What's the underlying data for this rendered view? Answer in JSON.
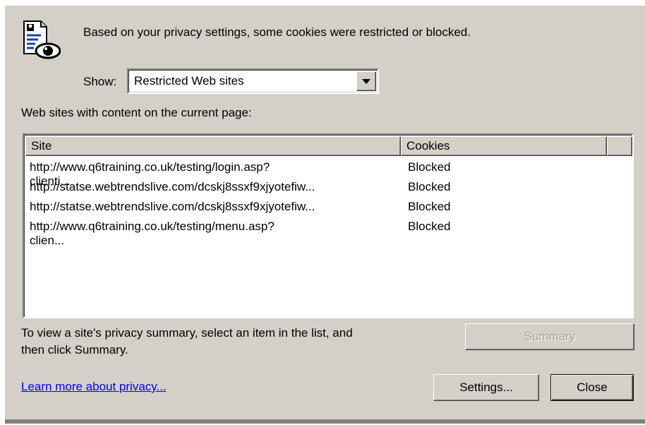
{
  "dialog": {
    "message": "Based on your privacy settings, some cookies were restricted or blocked.",
    "show_label": "Show:",
    "show_value": "Restricted Web sites",
    "list_caption": "Web sites with content on the current page:",
    "columns": {
      "site": "Site",
      "cookies": "Cookies"
    },
    "rows": [
      {
        "site": "http://www.q6training.co.uk/testing/login.asp?clienti...",
        "cookies": "Blocked"
      },
      {
        "site": "http://statse.webtrendslive.com/dcskj8ssxf9xjyotefiw...",
        "cookies": "Blocked"
      },
      {
        "site": "http://statse.webtrendslive.com/dcskj8ssxf9xjyotefiw...",
        "cookies": "Blocked"
      },
      {
        "site": "http://www.q6training.co.uk/testing/menu.asp?clien...",
        "cookies": "Blocked"
      }
    ],
    "hint_line1": "To view a site's privacy summary, select an item in the list, and",
    "hint_line2": "then click Summary.",
    "summary_label": "Summary",
    "learn_more": "Learn more about privacy...",
    "settings_label": "Settings...",
    "close_label": "Close",
    "icons": {
      "privacy": "privacy-report-eye-icon",
      "dropdown": "chevron-down-icon"
    }
  }
}
